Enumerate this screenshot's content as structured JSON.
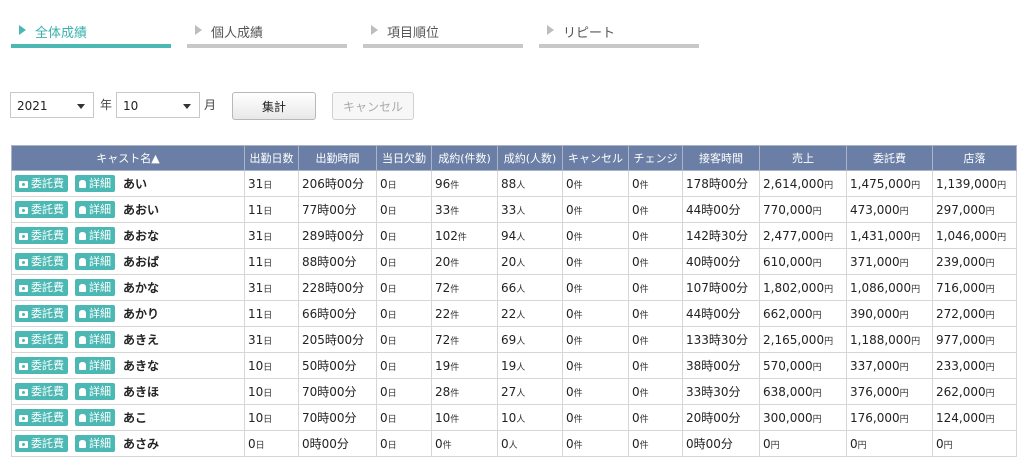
{
  "tabs": [
    {
      "label": "全体成績",
      "active": true
    },
    {
      "label": "個人成績",
      "active": false
    },
    {
      "label": "項目順位",
      "active": false
    },
    {
      "label": "リピート",
      "active": false
    }
  ],
  "filters": {
    "year": "2021",
    "year_unit": "年",
    "month": "10",
    "month_unit": "月",
    "submit_label": "集計",
    "cancel_label": "キャンセル"
  },
  "colors": {
    "accent": "#4bb8b3",
    "header_bg": "#6b7fa6"
  },
  "table": {
    "headers": [
      "キャスト名▲",
      "出勤日数",
      "出勤時間",
      "当日欠勤",
      "成約(件数)",
      "成約(人数)",
      "キャンセル",
      "チェンジ",
      "接客時間",
      "売上",
      "委託費",
      "店落"
    ],
    "action_labels": {
      "fee": "委託費",
      "detail": "詳細"
    },
    "units": {
      "day": "日",
      "ken": "件",
      "nin": "人",
      "yen": "円"
    },
    "rows": [
      {
        "name": "あい",
        "days": "31",
        "hours": "206時00分",
        "absent": "0",
        "deals": "96",
        "people": "88",
        "cancel": "0",
        "change": "0",
        "service": "178時00分",
        "sales": "2,614,000",
        "fee": "1,475,000",
        "store": "1,139,000"
      },
      {
        "name": "あおい",
        "days": "11",
        "hours": "77時00分",
        "absent": "0",
        "deals": "33",
        "people": "33",
        "cancel": "0",
        "change": "0",
        "service": "44時00分",
        "sales": "770,000",
        "fee": "473,000",
        "store": "297,000"
      },
      {
        "name": "あおな",
        "days": "31",
        "hours": "289時00分",
        "absent": "0",
        "deals": "102",
        "people": "94",
        "cancel": "0",
        "change": "0",
        "service": "142時30分",
        "sales": "2,477,000",
        "fee": "1,431,000",
        "store": "1,046,000"
      },
      {
        "name": "あおば",
        "days": "11",
        "hours": "88時00分",
        "absent": "0",
        "deals": "20",
        "people": "20",
        "cancel": "0",
        "change": "0",
        "service": "40時00分",
        "sales": "610,000",
        "fee": "371,000",
        "store": "239,000"
      },
      {
        "name": "あかな",
        "days": "31",
        "hours": "228時00分",
        "absent": "0",
        "deals": "72",
        "people": "66",
        "cancel": "0",
        "change": "0",
        "service": "107時00分",
        "sales": "1,802,000",
        "fee": "1,086,000",
        "store": "716,000"
      },
      {
        "name": "あかり",
        "days": "11",
        "hours": "66時00分",
        "absent": "0",
        "deals": "22",
        "people": "22",
        "cancel": "0",
        "change": "0",
        "service": "44時00分",
        "sales": "662,000",
        "fee": "390,000",
        "store": "272,000"
      },
      {
        "name": "あきえ",
        "days": "31",
        "hours": "205時00分",
        "absent": "0",
        "deals": "72",
        "people": "69",
        "cancel": "0",
        "change": "0",
        "service": "133時30分",
        "sales": "2,165,000",
        "fee": "1,188,000",
        "store": "977,000"
      },
      {
        "name": "あきな",
        "days": "10",
        "hours": "50時00分",
        "absent": "0",
        "deals": "19",
        "people": "19",
        "cancel": "0",
        "change": "0",
        "service": "38時00分",
        "sales": "570,000",
        "fee": "337,000",
        "store": "233,000"
      },
      {
        "name": "あきほ",
        "days": "10",
        "hours": "70時00分",
        "absent": "0",
        "deals": "28",
        "people": "27",
        "cancel": "0",
        "change": "0",
        "service": "33時30分",
        "sales": "638,000",
        "fee": "376,000",
        "store": "262,000"
      },
      {
        "name": "あこ",
        "days": "10",
        "hours": "70時00分",
        "absent": "0",
        "deals": "10",
        "people": "10",
        "cancel": "0",
        "change": "0",
        "service": "20時00分",
        "sales": "300,000",
        "fee": "176,000",
        "store": "124,000"
      },
      {
        "name": "あさみ",
        "days": "0",
        "hours": "0時00分",
        "absent": "0",
        "deals": "0",
        "people": "0",
        "cancel": "0",
        "change": "0",
        "service": "0時00分",
        "sales": "0",
        "fee": "0",
        "store": "0"
      }
    ]
  }
}
